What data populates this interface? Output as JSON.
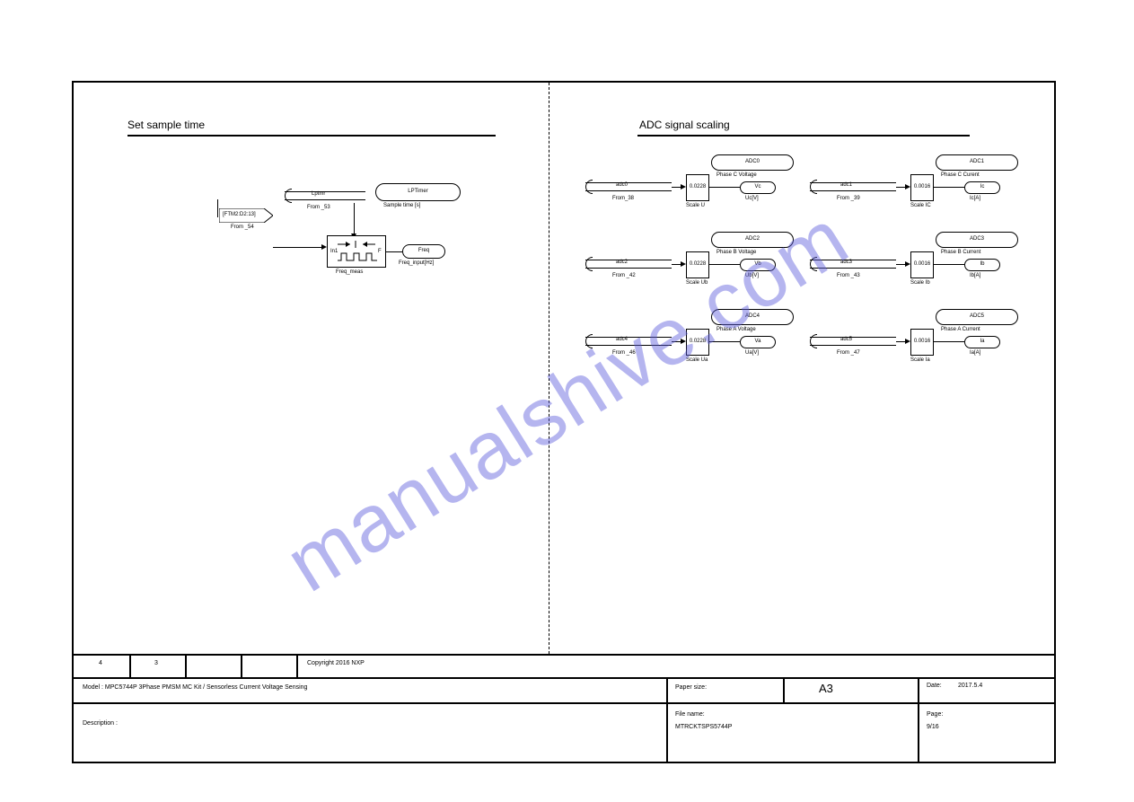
{
  "left": {
    "title": "Set sample time",
    "flag": "[FTM2:D2:13]",
    "flag_sub": "From _54",
    "bus": "Lptmr",
    "bus_sub": "From _53",
    "pill_main": "LPTimer",
    "pill_main_sub": "Sample time [s]",
    "freq_in": "In1",
    "freq_out": "F",
    "freq_name": "Freq_meas",
    "out_pill": "Freq",
    "out_sub": "Freq_input[Hz]"
  },
  "right": {
    "title": "ADC signal scaling",
    "nodes": [
      {
        "bus": "adc0",
        "bus_sub": "From_38",
        "pill_top": "ADC0",
        "pill_top_sub": "Phase C Voltage",
        "gain": "0.0228",
        "gain_sub": "Scale U",
        "out": "Vc",
        "out_sub": "Uc[V]"
      },
      {
        "bus": "adc1",
        "bus_sub": "From _39",
        "pill_top": "ADC1",
        "pill_top_sub": "Phase C Curent",
        "gain": "0.0016",
        "gain_sub": "Scale IC",
        "out": "Ic",
        "out_sub": "Ic[A]"
      },
      {
        "bus": "adc2",
        "bus_sub": "From _42",
        "pill_top": "ADC2",
        "pill_top_sub": "Phase B Voltage",
        "gain": "0.0228",
        "gain_sub": "Scale Ub",
        "out": "Vb",
        "out_sub": "Ub[V]"
      },
      {
        "bus": "adc3",
        "bus_sub": "From _43",
        "pill_top": "ADC3",
        "pill_top_sub": "Phase B Current",
        "gain": "0.0016",
        "gain_sub": "Scale Ib",
        "out": "Ib",
        "out_sub": "Ib[A]"
      },
      {
        "bus": "adc4",
        "bus_sub": "From _46",
        "pill_top": "ADC4",
        "pill_top_sub": "Phase A Voltage",
        "gain": "0.0228",
        "gain_sub": "Scale Ua",
        "out": "Va",
        "out_sub": "Ua[V]"
      },
      {
        "bus": "adc5",
        "bus_sub": "From _47",
        "pill_top": "ADC5",
        "pill_top_sub": "Phase A Current",
        "gain": "0.0016",
        "gain_sub": "Scale Ia",
        "out": "Ia",
        "out_sub": "Ia[A]"
      }
    ]
  },
  "title_block": {
    "row1": {
      "c1": "4",
      "c2": "3",
      "c3": "Copyright 2016 NXP"
    },
    "row2": {
      "left": "Model : MPC5744P 3Phase PMSM MC Kit / Sensorless Current Voltage Sensing",
      "c_paper": "Paper size:",
      "a3": "A3",
      "date_lbl": "Date:",
      "date": "2017.5.4"
    },
    "row3": {
      "left": "Description :",
      "file_lbl": "File name:",
      "file": "MTRCKTSPS5744P",
      "page_lbl": "Page:",
      "page": "9/16"
    }
  },
  "watermark": "manualshive.com"
}
